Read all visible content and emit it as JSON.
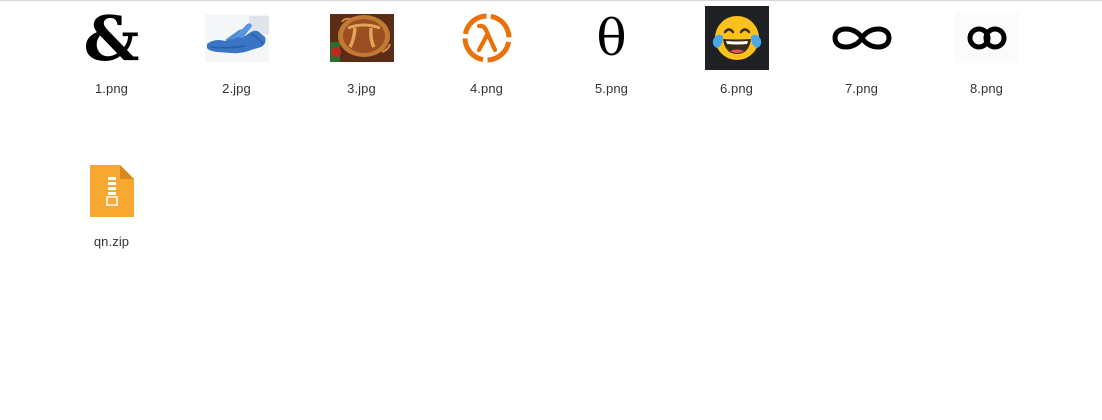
{
  "files": [
    {
      "name": "1.png",
      "icon": "ampersand-icon",
      "glyph": "&"
    },
    {
      "name": "2.jpg",
      "icon": "gloved-hand-photo"
    },
    {
      "name": "3.jpg",
      "icon": "pi-pie-photo"
    },
    {
      "name": "4.png",
      "icon": "lambda-logo-icon",
      "color": "#e8710a"
    },
    {
      "name": "5.png",
      "icon": "theta-icon",
      "glyph": "θ"
    },
    {
      "name": "6.png",
      "icon": "laughing-crying-emoji-icon"
    },
    {
      "name": "7.png",
      "icon": "infinity-icon"
    },
    {
      "name": "8.png",
      "icon": "linked-loops-icon"
    },
    {
      "name": "qn.zip",
      "icon": "zip-archive-icon",
      "color": "#f6a830"
    }
  ]
}
